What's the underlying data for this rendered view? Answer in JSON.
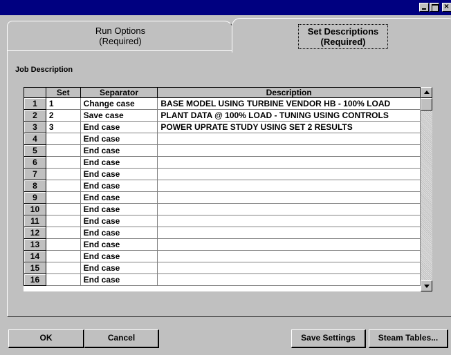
{
  "titlebar": {
    "close_glyph": "×",
    "min_icon": "minimize-icon",
    "max_icon": "maximize-icon",
    "close_icon": "close-icon"
  },
  "tabs": {
    "run_options": {
      "line1": "Run Options",
      "line2": "(Required)"
    },
    "set_descriptions": {
      "line1": "Set Descriptions",
      "line2": "(Required)"
    }
  },
  "job_description_label": "Job Description",
  "table": {
    "headers": [
      "",
      "Set",
      "Separator",
      "Description"
    ],
    "rows": [
      {
        "num": "1",
        "set": "1",
        "separator": "Change case",
        "description": "BASE MODEL USING TURBINE VENDOR HB - 100% LOAD"
      },
      {
        "num": "2",
        "set": "2",
        "separator": "Save case",
        "description": "PLANT DATA @ 100% LOAD - TUNING USING CONTROLS"
      },
      {
        "num": "3",
        "set": "3",
        "separator": "End case",
        "description": "POWER UPRATE STUDY USING SET 2 RESULTS"
      },
      {
        "num": "4",
        "set": "",
        "separator": "End case",
        "description": ""
      },
      {
        "num": "5",
        "set": "",
        "separator": "End case",
        "description": ""
      },
      {
        "num": "6",
        "set": "",
        "separator": "End case",
        "description": ""
      },
      {
        "num": "7",
        "set": "",
        "separator": "End case",
        "description": ""
      },
      {
        "num": "8",
        "set": "",
        "separator": "End case",
        "description": ""
      },
      {
        "num": "9",
        "set": "",
        "separator": "End case",
        "description": ""
      },
      {
        "num": "10",
        "set": "",
        "separator": "End case",
        "description": ""
      },
      {
        "num": "11",
        "set": "",
        "separator": "End case",
        "description": ""
      },
      {
        "num": "12",
        "set": "",
        "separator": "End case",
        "description": ""
      },
      {
        "num": "13",
        "set": "",
        "separator": "End case",
        "description": ""
      },
      {
        "num": "14",
        "set": "",
        "separator": "End case",
        "description": ""
      },
      {
        "num": "15",
        "set": "",
        "separator": "End case",
        "description": ""
      },
      {
        "num": "16",
        "set": "",
        "separator": "End case",
        "description": ""
      }
    ]
  },
  "buttons": {
    "ok": "OK",
    "cancel": "Cancel",
    "save_settings": "Save Settings",
    "steam_tables": "Steam Tables..."
  },
  "colors": {
    "titlebar": "#000080",
    "face": "#c0c0c0"
  }
}
